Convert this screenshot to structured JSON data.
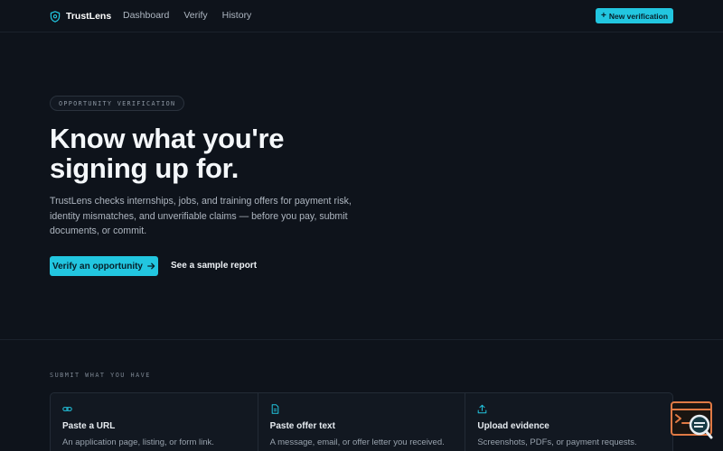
{
  "nav": {
    "brand": "TrustLens",
    "links": [
      "Dashboard",
      "Verify",
      "History"
    ],
    "new_button": "New verification",
    "new_button_icon": "plus-icon"
  },
  "hero": {
    "pill": "OPPORTUNITY VERIFICATION",
    "title_line1": "Know what you're",
    "title_line2": "signing up for.",
    "description": "TrustLens checks internships, jobs, and training offers for payment risk, identity mismatches, and unverifiable claims — before you pay, submit documents, or commit.",
    "primary_button": "Verify an opportunity",
    "primary_button_icon": "arrow-right-icon",
    "secondary_link": "See a sample report"
  },
  "submit": {
    "label": "SUBMIT WHAT YOU HAVE",
    "cards": [
      {
        "icon": "link-icon",
        "title": "Paste a URL",
        "desc": "An application page, listing, or form link."
      },
      {
        "icon": "document-icon",
        "title": "Paste offer text",
        "desc": "A message, email, or offer letter you received."
      },
      {
        "icon": "upload-icon",
        "title": "Upload evidence",
        "desc": "Screenshots, PDFs, or payment requests."
      }
    ]
  },
  "colors": {
    "background": "#0e131b",
    "accent": "#22c6e0",
    "widget_accent": "#e07a45"
  }
}
